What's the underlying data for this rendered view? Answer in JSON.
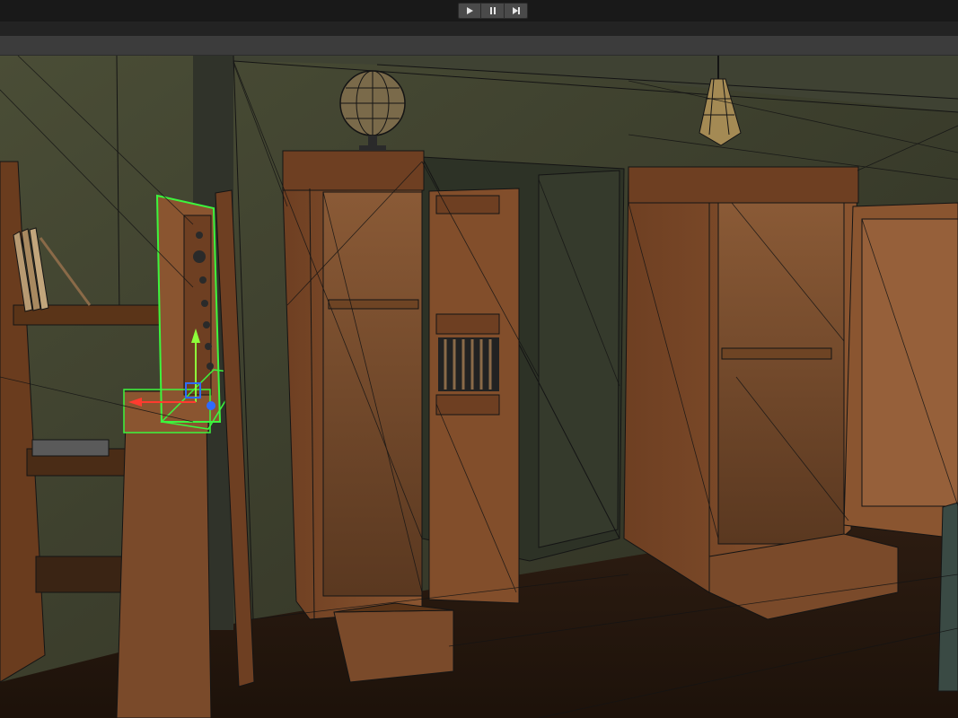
{
  "window": {
    "background": "#1e1e1e"
  },
  "play_controls": {
    "play_icon": "play-icon",
    "pause_icon": "pause-icon",
    "step_icon": "step-forward-icon",
    "button_color": "#4a4a4a",
    "glyph_color": "#e6e6e6"
  },
  "scene_view": {
    "wall_color": "#3a3d2c",
    "floor_color": "#2a1a10",
    "wood_color": "#7a4a2a",
    "wireframe_color": "#141414",
    "selection_outline_color": "#3df53d",
    "gizmo": {
      "x_axis_color": "#ff3b2f",
      "y_axis_color": "#8dff3a",
      "z_axis_color": "#2f6bff"
    }
  }
}
